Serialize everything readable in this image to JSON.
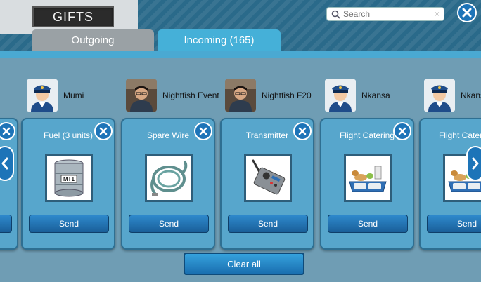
{
  "header": {
    "title": "GIFTS"
  },
  "search": {
    "placeholder": "Search",
    "clear_glyph": "×"
  },
  "tabs": [
    {
      "label": "Outgoing",
      "active": false
    },
    {
      "label": "Incoming (165)",
      "active": true
    }
  ],
  "senders": [
    {
      "name": "Mumi",
      "avatar": "pilot-avatar"
    },
    {
      "name": "Nightfish Event",
      "avatar": "man-photo"
    },
    {
      "name": "Nightfish F20",
      "avatar": "man-photo"
    },
    {
      "name": "Nkansa",
      "avatar": "pilot-avatar"
    },
    {
      "name": "Nkansa",
      "avatar": "pilot-avatar"
    }
  ],
  "cards": [
    {
      "title": "Fuel (3 units)",
      "icon": "fuel-barrel",
      "barrel_label": "MT1",
      "button": "Send"
    },
    {
      "title": "Spare Wire",
      "icon": "wire-coil",
      "button": "Send"
    },
    {
      "title": "Transmitter",
      "icon": "transmitter",
      "button": "Send"
    },
    {
      "title": "Flight Catering",
      "icon": "food-tray",
      "button": "Send"
    },
    {
      "title": "Flight Catering",
      "icon": "food-tray",
      "button": "Send"
    }
  ],
  "footer": {
    "clear_all_label": "Clear all"
  },
  "colors": {
    "accent": "#1d74b8",
    "tab_active": "#45b0d8",
    "card": "#57a6cc",
    "background": "#6f9db4"
  }
}
